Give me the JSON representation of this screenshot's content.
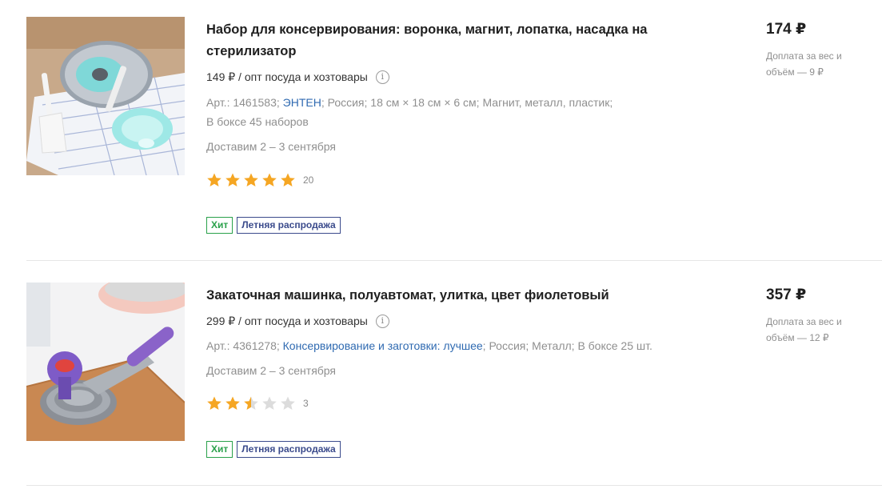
{
  "products": [
    {
      "title": "Набор для консервирования: воронка, магнит, лопатка, насадка на стерилизатор",
      "wholesale": "149 ₽ / опт посуда и хозтовары",
      "art": "Арт.: 1461583;",
      "brand": "ЭНТЕН",
      "specs_rest": "; Россия; 18 см × 18 см × 6 см; Магнит, металл, пластик;",
      "specs_line2": "В боксе 45 наборов",
      "delivery": "Доставим 2 – 3 сентября",
      "rating": 5,
      "reviews": "20",
      "badge_hit": "Хит",
      "badge_sale": "Летняя распродажа",
      "price": "174 ₽",
      "surcharge": "Доплата за вес и объём — 9 ₽"
    },
    {
      "title": "Закаточная машинка, полуавтомат, улитка, цвет фиолетовый",
      "wholesale": "299 ₽ / опт посуда и хозтовары",
      "art": "Арт.: 4361278;",
      "brand": "Консервирование и заготовки: лучшее",
      "specs_rest": "; Россия; Металл; В боксе 25 шт.",
      "delivery": "Доставим 2 – 3 сентября",
      "rating": 2.5,
      "reviews": "3",
      "badge_hit": "Хит",
      "badge_sale": "Летняя распродажа",
      "price": "357 ₽",
      "surcharge": "Доплата за вес и объём — 12 ₽"
    }
  ],
  "colors": {
    "star_filled": "#f5a623",
    "star_empty": "#dcdcdc",
    "link": "#2f6ab1"
  },
  "icons": [
    "info-icon",
    "star-icon"
  ]
}
